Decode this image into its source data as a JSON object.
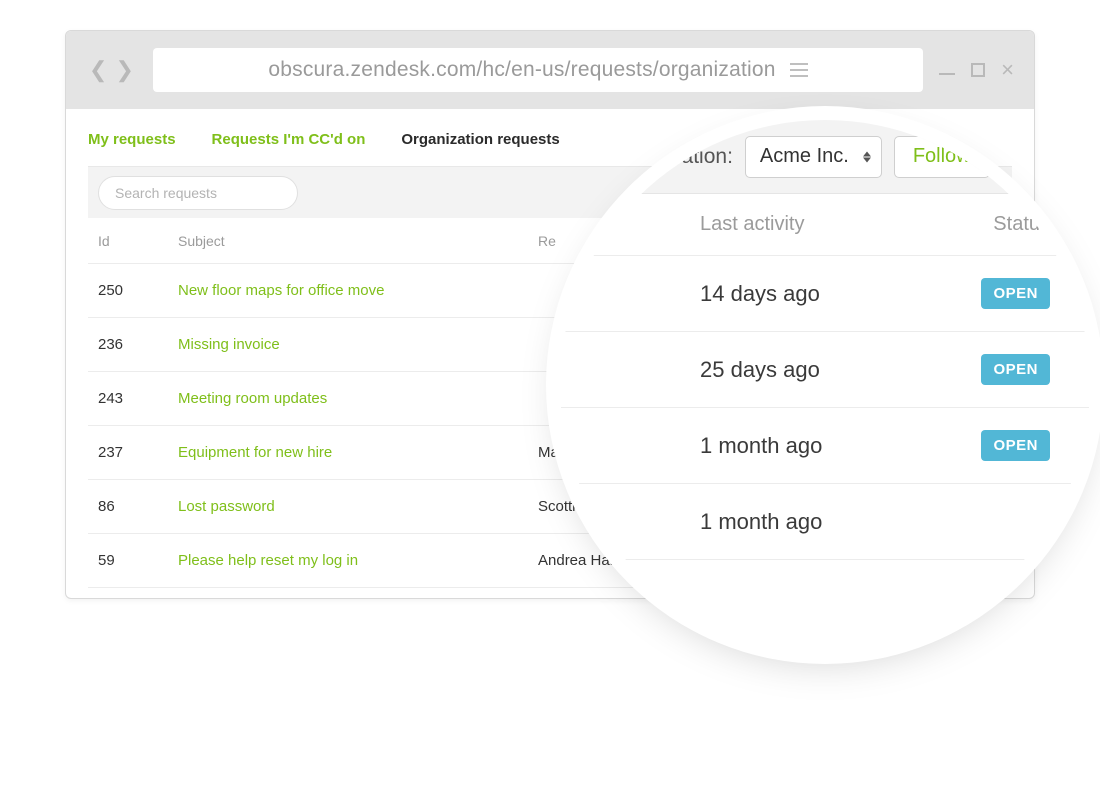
{
  "browser": {
    "url": "obscura.zendesk.com/hc/en-us/requests/organization"
  },
  "tabs": {
    "my_requests": "My requests",
    "ccd": "Requests I'm CC'd on",
    "org": "Organization requests"
  },
  "search": {
    "placeholder": "Search requests"
  },
  "columns": {
    "id": "Id",
    "subject": "Subject",
    "requester": "Re"
  },
  "rows": [
    {
      "id": "250",
      "subject": "New floor maps for office move",
      "requester": ""
    },
    {
      "id": "236",
      "subject": "Missing invoice",
      "requester": ""
    },
    {
      "id": "243",
      "subject": "Meeting room updates",
      "requester": ""
    },
    {
      "id": "237",
      "subject": "Equipment for new hire",
      "requester": "Ma"
    },
    {
      "id": "86",
      "subject": "Lost password",
      "requester": "Scottie"
    },
    {
      "id": "59",
      "subject": "Please help reset my log in",
      "requester": "Andrea Harpe"
    }
  ],
  "magnifier": {
    "org_label": "Organization:",
    "org_value": "Acme Inc.",
    "follow": "Follow",
    "head_activity": "Last activity",
    "head_status": "Status",
    "rows": [
      {
        "activity": "14 days ago",
        "status": "OPEN"
      },
      {
        "activity": "25 days ago",
        "status": "OPEN"
      },
      {
        "activity": "1 month ago",
        "status": "OPEN"
      },
      {
        "activity": "1 month ago",
        "status": ""
      }
    ]
  }
}
